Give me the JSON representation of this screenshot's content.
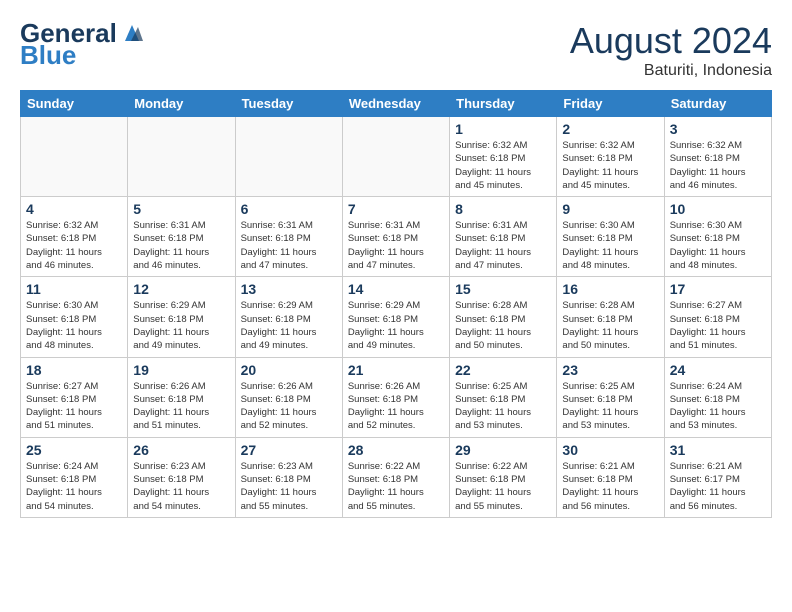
{
  "header": {
    "logo_general": "General",
    "logo_blue": "Blue",
    "month": "August 2024",
    "location": "Baturiti, Indonesia"
  },
  "days_of_week": [
    "Sunday",
    "Monday",
    "Tuesday",
    "Wednesday",
    "Thursday",
    "Friday",
    "Saturday"
  ],
  "weeks": [
    [
      {
        "day": "",
        "info": "",
        "empty": true
      },
      {
        "day": "",
        "info": "",
        "empty": true
      },
      {
        "day": "",
        "info": "",
        "empty": true
      },
      {
        "day": "",
        "info": "",
        "empty": true
      },
      {
        "day": "1",
        "info": "Sunrise: 6:32 AM\nSunset: 6:18 PM\nDaylight: 11 hours\nand 45 minutes.",
        "empty": false
      },
      {
        "day": "2",
        "info": "Sunrise: 6:32 AM\nSunset: 6:18 PM\nDaylight: 11 hours\nand 45 minutes.",
        "empty": false
      },
      {
        "day": "3",
        "info": "Sunrise: 6:32 AM\nSunset: 6:18 PM\nDaylight: 11 hours\nand 46 minutes.",
        "empty": false
      }
    ],
    [
      {
        "day": "4",
        "info": "Sunrise: 6:32 AM\nSunset: 6:18 PM\nDaylight: 11 hours\nand 46 minutes.",
        "empty": false
      },
      {
        "day": "5",
        "info": "Sunrise: 6:31 AM\nSunset: 6:18 PM\nDaylight: 11 hours\nand 46 minutes.",
        "empty": false
      },
      {
        "day": "6",
        "info": "Sunrise: 6:31 AM\nSunset: 6:18 PM\nDaylight: 11 hours\nand 47 minutes.",
        "empty": false
      },
      {
        "day": "7",
        "info": "Sunrise: 6:31 AM\nSunset: 6:18 PM\nDaylight: 11 hours\nand 47 minutes.",
        "empty": false
      },
      {
        "day": "8",
        "info": "Sunrise: 6:31 AM\nSunset: 6:18 PM\nDaylight: 11 hours\nand 47 minutes.",
        "empty": false
      },
      {
        "day": "9",
        "info": "Sunrise: 6:30 AM\nSunset: 6:18 PM\nDaylight: 11 hours\nand 48 minutes.",
        "empty": false
      },
      {
        "day": "10",
        "info": "Sunrise: 6:30 AM\nSunset: 6:18 PM\nDaylight: 11 hours\nand 48 minutes.",
        "empty": false
      }
    ],
    [
      {
        "day": "11",
        "info": "Sunrise: 6:30 AM\nSunset: 6:18 PM\nDaylight: 11 hours\nand 48 minutes.",
        "empty": false
      },
      {
        "day": "12",
        "info": "Sunrise: 6:29 AM\nSunset: 6:18 PM\nDaylight: 11 hours\nand 49 minutes.",
        "empty": false
      },
      {
        "day": "13",
        "info": "Sunrise: 6:29 AM\nSunset: 6:18 PM\nDaylight: 11 hours\nand 49 minutes.",
        "empty": false
      },
      {
        "day": "14",
        "info": "Sunrise: 6:29 AM\nSunset: 6:18 PM\nDaylight: 11 hours\nand 49 minutes.",
        "empty": false
      },
      {
        "day": "15",
        "info": "Sunrise: 6:28 AM\nSunset: 6:18 PM\nDaylight: 11 hours\nand 50 minutes.",
        "empty": false
      },
      {
        "day": "16",
        "info": "Sunrise: 6:28 AM\nSunset: 6:18 PM\nDaylight: 11 hours\nand 50 minutes.",
        "empty": false
      },
      {
        "day": "17",
        "info": "Sunrise: 6:27 AM\nSunset: 6:18 PM\nDaylight: 11 hours\nand 51 minutes.",
        "empty": false
      }
    ],
    [
      {
        "day": "18",
        "info": "Sunrise: 6:27 AM\nSunset: 6:18 PM\nDaylight: 11 hours\nand 51 minutes.",
        "empty": false
      },
      {
        "day": "19",
        "info": "Sunrise: 6:26 AM\nSunset: 6:18 PM\nDaylight: 11 hours\nand 51 minutes.",
        "empty": false
      },
      {
        "day": "20",
        "info": "Sunrise: 6:26 AM\nSunset: 6:18 PM\nDaylight: 11 hours\nand 52 minutes.",
        "empty": false
      },
      {
        "day": "21",
        "info": "Sunrise: 6:26 AM\nSunset: 6:18 PM\nDaylight: 11 hours\nand 52 minutes.",
        "empty": false
      },
      {
        "day": "22",
        "info": "Sunrise: 6:25 AM\nSunset: 6:18 PM\nDaylight: 11 hours\nand 53 minutes.",
        "empty": false
      },
      {
        "day": "23",
        "info": "Sunrise: 6:25 AM\nSunset: 6:18 PM\nDaylight: 11 hours\nand 53 minutes.",
        "empty": false
      },
      {
        "day": "24",
        "info": "Sunrise: 6:24 AM\nSunset: 6:18 PM\nDaylight: 11 hours\nand 53 minutes.",
        "empty": false
      }
    ],
    [
      {
        "day": "25",
        "info": "Sunrise: 6:24 AM\nSunset: 6:18 PM\nDaylight: 11 hours\nand 54 minutes.",
        "empty": false
      },
      {
        "day": "26",
        "info": "Sunrise: 6:23 AM\nSunset: 6:18 PM\nDaylight: 11 hours\nand 54 minutes.",
        "empty": false
      },
      {
        "day": "27",
        "info": "Sunrise: 6:23 AM\nSunset: 6:18 PM\nDaylight: 11 hours\nand 55 minutes.",
        "empty": false
      },
      {
        "day": "28",
        "info": "Sunrise: 6:22 AM\nSunset: 6:18 PM\nDaylight: 11 hours\nand 55 minutes.",
        "empty": false
      },
      {
        "day": "29",
        "info": "Sunrise: 6:22 AM\nSunset: 6:18 PM\nDaylight: 11 hours\nand 55 minutes.",
        "empty": false
      },
      {
        "day": "30",
        "info": "Sunrise: 6:21 AM\nSunset: 6:18 PM\nDaylight: 11 hours\nand 56 minutes.",
        "empty": false
      },
      {
        "day": "31",
        "info": "Sunrise: 6:21 AM\nSunset: 6:17 PM\nDaylight: 11 hours\nand 56 minutes.",
        "empty": false
      }
    ]
  ]
}
